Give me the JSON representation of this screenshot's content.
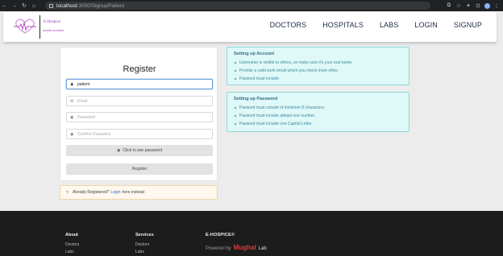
{
  "browser": {
    "back": "←",
    "forward": "→",
    "reload": "↻",
    "home": "⌂",
    "url_host": "localhost",
    "url_path": ":3000/SignupPatient",
    "actions": [
      "⧉",
      "☆",
      "✦",
      "⊡",
      "▢",
      "⋮"
    ]
  },
  "header": {
    "brand": "E-Hospice",
    "tagline": "health moment",
    "nav": [
      "DOCTORS",
      "HOSPITALS",
      "LABS",
      "LOGIN",
      "SIGNUP"
    ],
    "colors": {
      "brand": "#9b3cb2",
      "nav": "#1c2a4a"
    }
  },
  "register": {
    "title": "Register",
    "name_value": "patient",
    "email_placeholder": "Email",
    "password_placeholder": "Password",
    "confirm_placeholder": "Confirm Password",
    "show_password_label": "Click to see password",
    "submit_label": "Register",
    "icons": {
      "name": "user-icon",
      "email": "envelope-icon",
      "password": "lock-icon",
      "confirm": "lock-icon",
      "show": "eye-icon"
    }
  },
  "note": {
    "before": "Already Registered?",
    "link": "Login",
    "after": "here instead"
  },
  "account_info": {
    "title": "Setting up Account",
    "items": [
      "Username is visible to others, so make sure it's your real name.",
      "Provide a valid work email which you check more often.",
      "Pasword must include"
    ]
  },
  "password_info": {
    "title": "Setting up Password",
    "items": [
      "Pasword must consist of minimum 8 characters.",
      "Pasword must include atleast one number.",
      "Pasword must include one Capital Letter."
    ]
  },
  "footer": {
    "about_title": "About",
    "about_links": [
      "Doctors",
      "Labs"
    ],
    "services_title": "Services",
    "services_links": [
      "Doctors",
      "Labs"
    ],
    "brand": "E-HOSPICE©",
    "powered_by": "Powered by",
    "company": "Mughal",
    "company_suffix": "Lab",
    "accent_color": "#e53935"
  }
}
